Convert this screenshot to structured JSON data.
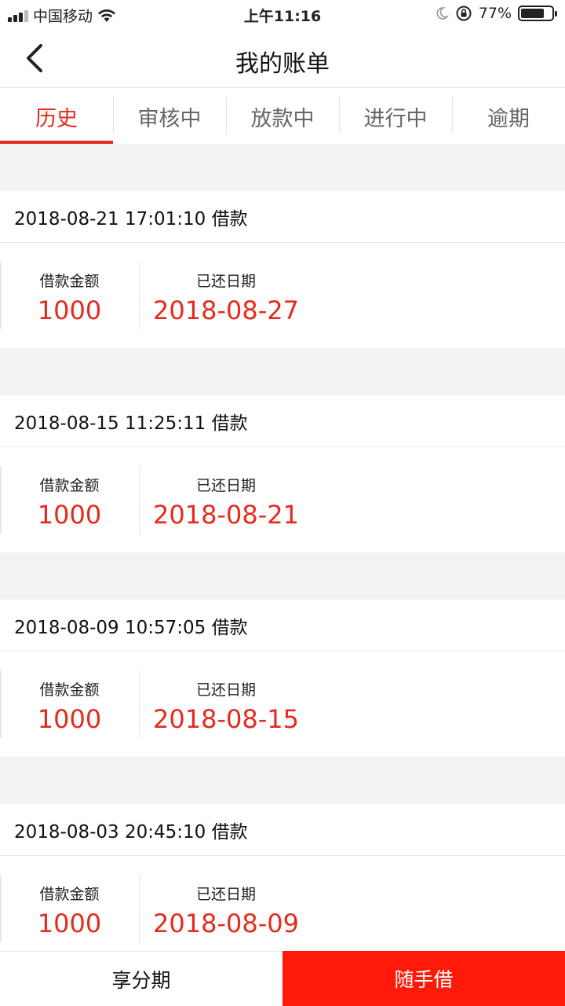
{
  "status_bar": {
    "carrier": "中国移动",
    "time": "上午11:16",
    "battery_percent": "77%",
    "battery_level": 0.77
  },
  "nav": {
    "title": "我的账单"
  },
  "tabs": [
    {
      "label": "历史",
      "active": true
    },
    {
      "label": "审核中",
      "active": false
    },
    {
      "label": "放款中",
      "active": false
    },
    {
      "label": "进行中",
      "active": false
    },
    {
      "label": "逾期",
      "active": false
    }
  ],
  "bills": [
    {
      "header": "2018-08-21 17:01:10 借款",
      "amount_label": "借款金额",
      "amount": "1000",
      "date_label": "已还日期",
      "date": "2018-08-27"
    },
    {
      "header": "2018-08-15 11:25:11 借款",
      "amount_label": "借款金额",
      "amount": "1000",
      "date_label": "已还日期",
      "date": "2018-08-21"
    },
    {
      "header": "2018-08-09 10:57:05 借款",
      "amount_label": "借款金额",
      "amount": "1000",
      "date_label": "已还日期",
      "date": "2018-08-15"
    },
    {
      "header": "2018-08-03 20:45:10 借款",
      "amount_label": "借款金额",
      "amount": "1000",
      "date_label": "已还日期",
      "date": "2018-08-09"
    }
  ],
  "bottom": {
    "left_label": "享分期",
    "right_label": "随手借"
  },
  "colors": {
    "accent": "#e52b1e",
    "primary_button": "#ff1a0a"
  }
}
